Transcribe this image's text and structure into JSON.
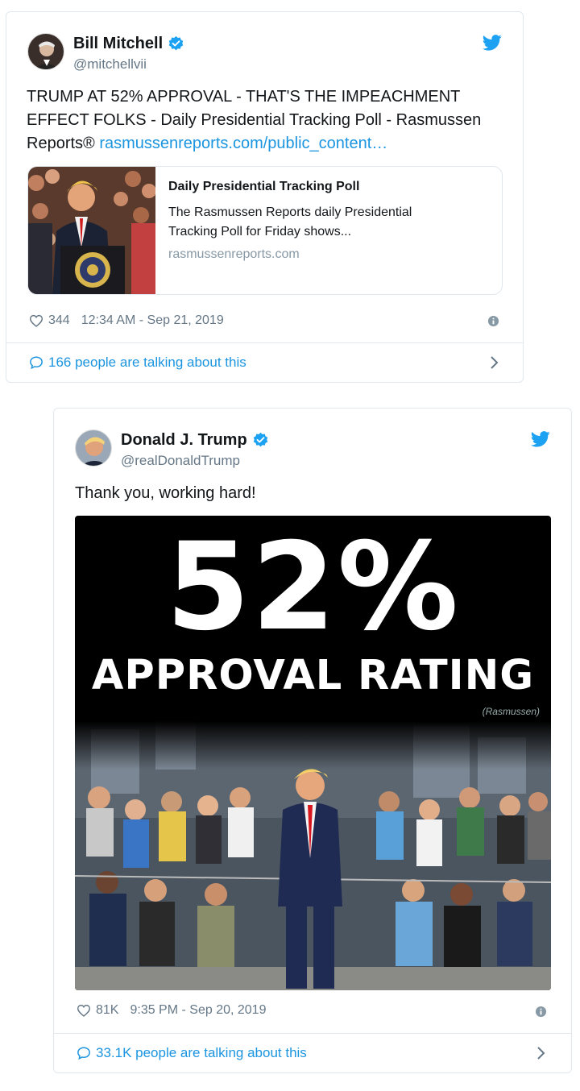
{
  "tweet1": {
    "author_name": "Bill Mitchell",
    "author_handle": "@mitchellvii",
    "text_main": "TRUMP AT 52% APPROVAL - THAT'S THE IMPEACHMENT EFFECT FOLKS - Daily Presidential Tracking Poll - Rasmussen Reports®",
    "text_link": "rasmussenreports.com/public_content…",
    "card": {
      "title": "Daily Presidential Tracking Poll",
      "description": "The Rasmussen Reports daily Presidential Tracking Poll for Friday shows...",
      "domain": "rasmussenreports.com"
    },
    "likes": "344",
    "timestamp": "12:34 AM - Sep 21, 2019",
    "talking": "166 people are talking about this"
  },
  "tweet2": {
    "author_name": "Donald J. Trump",
    "author_handle": "@realDonaldTrump",
    "text_main": "Thank you, working hard!",
    "image": {
      "headline": "52%",
      "subheadline": "APPROVAL RATING",
      "source": "(Rasmussen)"
    },
    "likes": "81K",
    "timestamp": "9:35 PM - Sep 20, 2019",
    "talking": "33.1K people are talking about this"
  },
  "colors": {
    "twitter_blue": "#1da1f2",
    "link": "#1b95e0",
    "muted": "#657786",
    "border": "#e1e8ed"
  },
  "icons": [
    "verified-icon",
    "twitter-bird-icon",
    "heart-icon",
    "info-icon",
    "comment-icon",
    "chevron-right-icon"
  ]
}
